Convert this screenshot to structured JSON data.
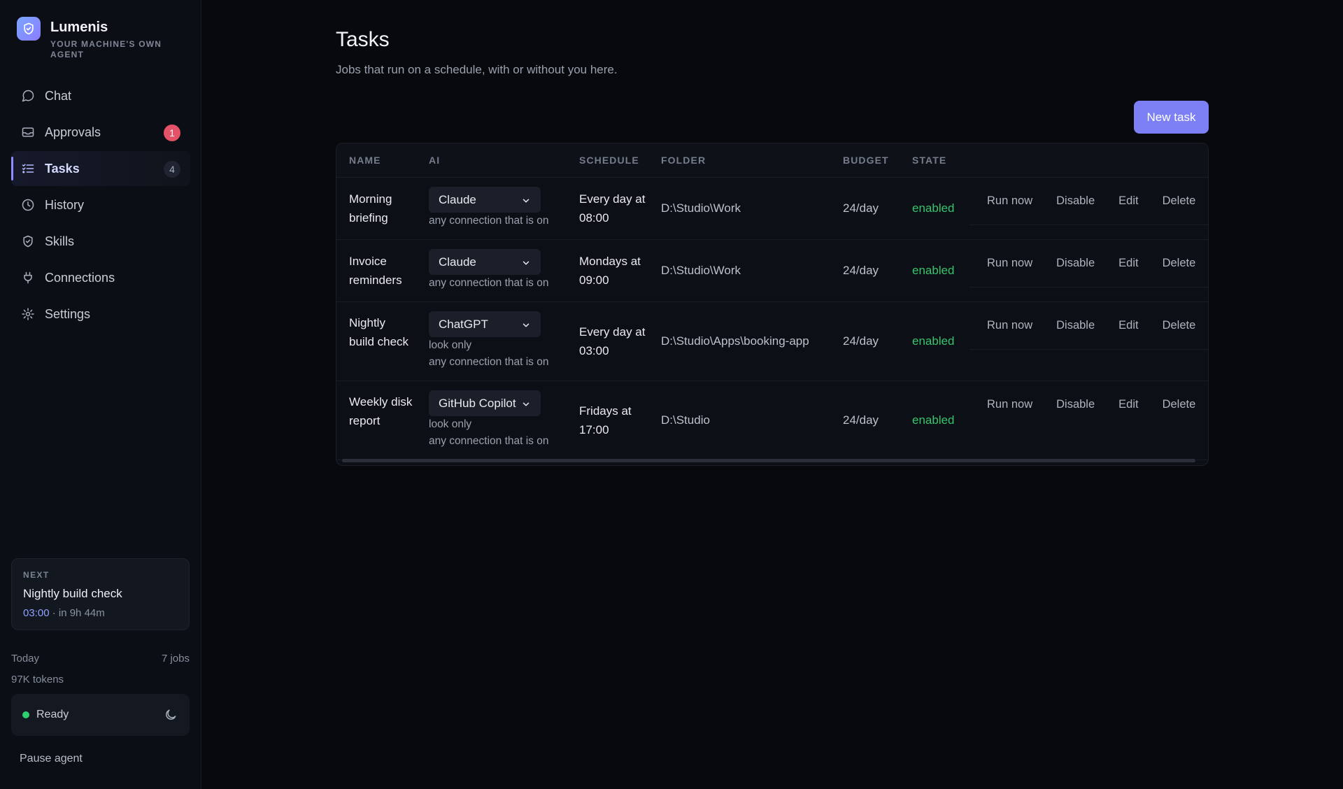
{
  "brand": {
    "name": "Lumenis",
    "tagline": "YOUR MACHINE'S OWN AGENT"
  },
  "nav": [
    {
      "label": "Chat",
      "icon": "chat-icon"
    },
    {
      "label": "Approvals",
      "icon": "inbox-icon",
      "badge": "1"
    },
    {
      "label": "Tasks",
      "icon": "list-icon",
      "badge": "4",
      "active": true
    },
    {
      "label": "History",
      "icon": "clock-icon"
    },
    {
      "label": "Skills",
      "icon": "shield-icon"
    },
    {
      "label": "Connections",
      "icon": "plug-icon"
    },
    {
      "label": "Settings",
      "icon": "gear-icon"
    }
  ],
  "next": {
    "label": "NEXT",
    "title": "Nightly build check",
    "time": "03:00",
    "eta": " · in 9h 44m"
  },
  "stats": {
    "today_label": "Today",
    "jobs": "7 jobs",
    "tokens": "97K tokens"
  },
  "status": {
    "text": "Ready",
    "color": "#2fcf6f"
  },
  "pause_label": "Pause agent",
  "page": {
    "title": "Tasks",
    "subtitle": "Jobs that run on a schedule, with or without you here.",
    "new_task_label": "New task"
  },
  "table": {
    "headers": {
      "name": "NAME",
      "ai": "AI",
      "schedule": "SCHEDULE",
      "folder": "FOLDER",
      "budget": "BUDGET",
      "state": "STATE"
    },
    "actions": [
      "Run now",
      "Disable",
      "Edit",
      "Delete"
    ],
    "rows": [
      {
        "name": "Morning briefing",
        "ai": "Claude",
        "notes": [
          "any connection that is on"
        ],
        "schedule": "Every day at 08:00",
        "folder": "D:\\Studio\\Work",
        "budget": "24/day",
        "state": "enabled"
      },
      {
        "name": "Invoice reminders",
        "ai": "Claude",
        "notes": [
          "any connection that is on"
        ],
        "schedule": "Mondays at 09:00",
        "folder": "D:\\Studio\\Work",
        "budget": "24/day",
        "state": "enabled"
      },
      {
        "name": "Nightly build check",
        "ai": "ChatGPT",
        "notes": [
          "look only",
          "any connection that is on"
        ],
        "schedule": "Every day at 03:00",
        "folder": "D:\\Studio\\Apps\\booking-app",
        "budget": "24/day",
        "state": "enabled"
      },
      {
        "name": "Weekly disk report",
        "ai": "GitHub Copilot",
        "notes": [
          "look only",
          "any connection that is on"
        ],
        "schedule": "Fridays at 17:00",
        "folder": "D:\\Studio",
        "budget": "24/day",
        "state": "enabled"
      }
    ]
  },
  "colors": {
    "accent": "#7d80f5",
    "enabled": "#37c46c",
    "badge_red": "#e35266",
    "bg": "#07090d"
  }
}
